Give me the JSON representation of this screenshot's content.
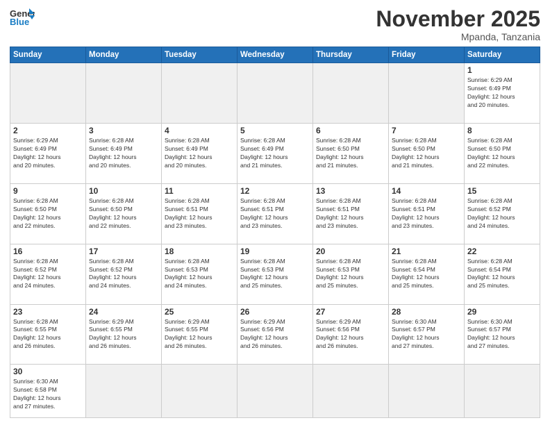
{
  "header": {
    "logo_general": "General",
    "logo_blue": "Blue",
    "month_title": "November 2025",
    "location": "Mpanda, Tanzania"
  },
  "weekdays": [
    "Sunday",
    "Monday",
    "Tuesday",
    "Wednesday",
    "Thursday",
    "Friday",
    "Saturday"
  ],
  "weeks": [
    [
      {
        "day": "",
        "info": "",
        "empty": true
      },
      {
        "day": "",
        "info": "",
        "empty": true
      },
      {
        "day": "",
        "info": "",
        "empty": true
      },
      {
        "day": "",
        "info": "",
        "empty": true
      },
      {
        "day": "",
        "info": "",
        "empty": true
      },
      {
        "day": "",
        "info": "",
        "empty": true
      },
      {
        "day": "1",
        "info": "Sunrise: 6:29 AM\nSunset: 6:49 PM\nDaylight: 12 hours\nand 20 minutes."
      }
    ],
    [
      {
        "day": "2",
        "info": "Sunrise: 6:29 AM\nSunset: 6:49 PM\nDaylight: 12 hours\nand 20 minutes."
      },
      {
        "day": "3",
        "info": "Sunrise: 6:28 AM\nSunset: 6:49 PM\nDaylight: 12 hours\nand 20 minutes."
      },
      {
        "day": "4",
        "info": "Sunrise: 6:28 AM\nSunset: 6:49 PM\nDaylight: 12 hours\nand 20 minutes."
      },
      {
        "day": "5",
        "info": "Sunrise: 6:28 AM\nSunset: 6:49 PM\nDaylight: 12 hours\nand 21 minutes."
      },
      {
        "day": "6",
        "info": "Sunrise: 6:28 AM\nSunset: 6:50 PM\nDaylight: 12 hours\nand 21 minutes."
      },
      {
        "day": "7",
        "info": "Sunrise: 6:28 AM\nSunset: 6:50 PM\nDaylight: 12 hours\nand 21 minutes."
      },
      {
        "day": "8",
        "info": "Sunrise: 6:28 AM\nSunset: 6:50 PM\nDaylight: 12 hours\nand 22 minutes."
      }
    ],
    [
      {
        "day": "9",
        "info": "Sunrise: 6:28 AM\nSunset: 6:50 PM\nDaylight: 12 hours\nand 22 minutes."
      },
      {
        "day": "10",
        "info": "Sunrise: 6:28 AM\nSunset: 6:50 PM\nDaylight: 12 hours\nand 22 minutes."
      },
      {
        "day": "11",
        "info": "Sunrise: 6:28 AM\nSunset: 6:51 PM\nDaylight: 12 hours\nand 23 minutes."
      },
      {
        "day": "12",
        "info": "Sunrise: 6:28 AM\nSunset: 6:51 PM\nDaylight: 12 hours\nand 23 minutes."
      },
      {
        "day": "13",
        "info": "Sunrise: 6:28 AM\nSunset: 6:51 PM\nDaylight: 12 hours\nand 23 minutes."
      },
      {
        "day": "14",
        "info": "Sunrise: 6:28 AM\nSunset: 6:51 PM\nDaylight: 12 hours\nand 23 minutes."
      },
      {
        "day": "15",
        "info": "Sunrise: 6:28 AM\nSunset: 6:52 PM\nDaylight: 12 hours\nand 24 minutes."
      }
    ],
    [
      {
        "day": "16",
        "info": "Sunrise: 6:28 AM\nSunset: 6:52 PM\nDaylight: 12 hours\nand 24 minutes."
      },
      {
        "day": "17",
        "info": "Sunrise: 6:28 AM\nSunset: 6:52 PM\nDaylight: 12 hours\nand 24 minutes."
      },
      {
        "day": "18",
        "info": "Sunrise: 6:28 AM\nSunset: 6:53 PM\nDaylight: 12 hours\nand 24 minutes."
      },
      {
        "day": "19",
        "info": "Sunrise: 6:28 AM\nSunset: 6:53 PM\nDaylight: 12 hours\nand 25 minutes."
      },
      {
        "day": "20",
        "info": "Sunrise: 6:28 AM\nSunset: 6:53 PM\nDaylight: 12 hours\nand 25 minutes."
      },
      {
        "day": "21",
        "info": "Sunrise: 6:28 AM\nSunset: 6:54 PM\nDaylight: 12 hours\nand 25 minutes."
      },
      {
        "day": "22",
        "info": "Sunrise: 6:28 AM\nSunset: 6:54 PM\nDaylight: 12 hours\nand 25 minutes."
      }
    ],
    [
      {
        "day": "23",
        "info": "Sunrise: 6:28 AM\nSunset: 6:55 PM\nDaylight: 12 hours\nand 26 minutes."
      },
      {
        "day": "24",
        "info": "Sunrise: 6:29 AM\nSunset: 6:55 PM\nDaylight: 12 hours\nand 26 minutes."
      },
      {
        "day": "25",
        "info": "Sunrise: 6:29 AM\nSunset: 6:55 PM\nDaylight: 12 hours\nand 26 minutes."
      },
      {
        "day": "26",
        "info": "Sunrise: 6:29 AM\nSunset: 6:56 PM\nDaylight: 12 hours\nand 26 minutes."
      },
      {
        "day": "27",
        "info": "Sunrise: 6:29 AM\nSunset: 6:56 PM\nDaylight: 12 hours\nand 26 minutes."
      },
      {
        "day": "28",
        "info": "Sunrise: 6:30 AM\nSunset: 6:57 PM\nDaylight: 12 hours\nand 27 minutes."
      },
      {
        "day": "29",
        "info": "Sunrise: 6:30 AM\nSunset: 6:57 PM\nDaylight: 12 hours\nand 27 minutes."
      }
    ],
    [
      {
        "day": "30",
        "info": "Sunrise: 6:30 AM\nSunset: 6:58 PM\nDaylight: 12 hours\nand 27 minutes."
      },
      {
        "day": "",
        "info": "",
        "empty": true
      },
      {
        "day": "",
        "info": "",
        "empty": true
      },
      {
        "day": "",
        "info": "",
        "empty": true
      },
      {
        "day": "",
        "info": "",
        "empty": true
      },
      {
        "day": "",
        "info": "",
        "empty": true
      },
      {
        "day": "",
        "info": "",
        "empty": true
      }
    ]
  ]
}
